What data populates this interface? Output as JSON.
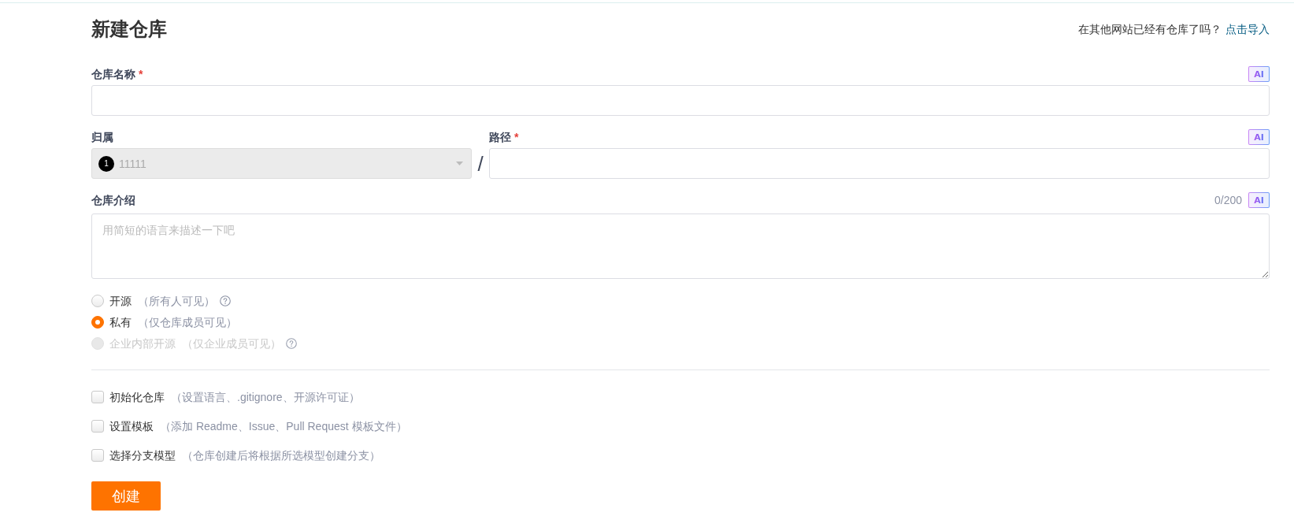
{
  "page": {
    "title": "新建仓库",
    "import_prompt": "在其他网站已经有仓库了吗？",
    "import_link": "点击导入"
  },
  "name_field": {
    "label": "仓库名称",
    "required_mark": "*",
    "ai_button": "AI"
  },
  "owner_field": {
    "label": "归属",
    "avatar": "1",
    "value": "11111",
    "disabled": true
  },
  "path_separator": "/",
  "path_field": {
    "label": "路径",
    "required_mark": "*",
    "ai_button": "AI"
  },
  "description_field": {
    "label": "仓库介绍",
    "counter": "0/200",
    "ai_button": "AI",
    "placeholder": "用简短的语言来描述一下吧"
  },
  "visibility": [
    {
      "label": "开源",
      "hint": "（所有人可见）",
      "selected": false,
      "disabled": false,
      "help": true
    },
    {
      "label": "私有",
      "hint": "（仅仓库成员可见）",
      "selected": true,
      "disabled": false,
      "help": false
    },
    {
      "label": "企业内部开源",
      "hint": "（仅企业成员可见）",
      "selected": false,
      "disabled": true,
      "help": true
    }
  ],
  "options": [
    {
      "label": "初始化仓库",
      "hint": "（设置语言、.gitignore、开源许可证）",
      "checked": false
    },
    {
      "label": "设置模板",
      "hint": "（添加 Readme、Issue、Pull Request 模板文件）",
      "checked": false
    },
    {
      "label": "选择分支模型",
      "hint": "（仓库创建后将根据所选模型创建分支）",
      "checked": false
    }
  ],
  "submit_button": "创建"
}
